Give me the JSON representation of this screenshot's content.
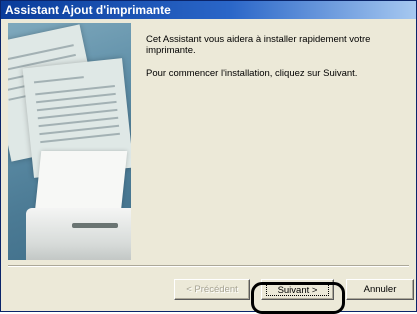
{
  "window": {
    "title": "Assistant Ajout d'imprimante"
  },
  "content": {
    "intro": "Cet Assistant vous aidera à installer rapidement votre imprimante.",
    "instruction": "Pour commencer l'installation, cliquez sur Suivant."
  },
  "buttons": {
    "back_label": "< Précédent",
    "next_label": "Suivant >",
    "cancel_label": "Annuler"
  },
  "annotation": {
    "highlight_target": "next-button",
    "highlight_color": "#000000"
  },
  "colors": {
    "title_bar_start": "#0a3c9a",
    "title_bar_end": "#a6c8f0",
    "dialog_background": "#ece9d8"
  }
}
